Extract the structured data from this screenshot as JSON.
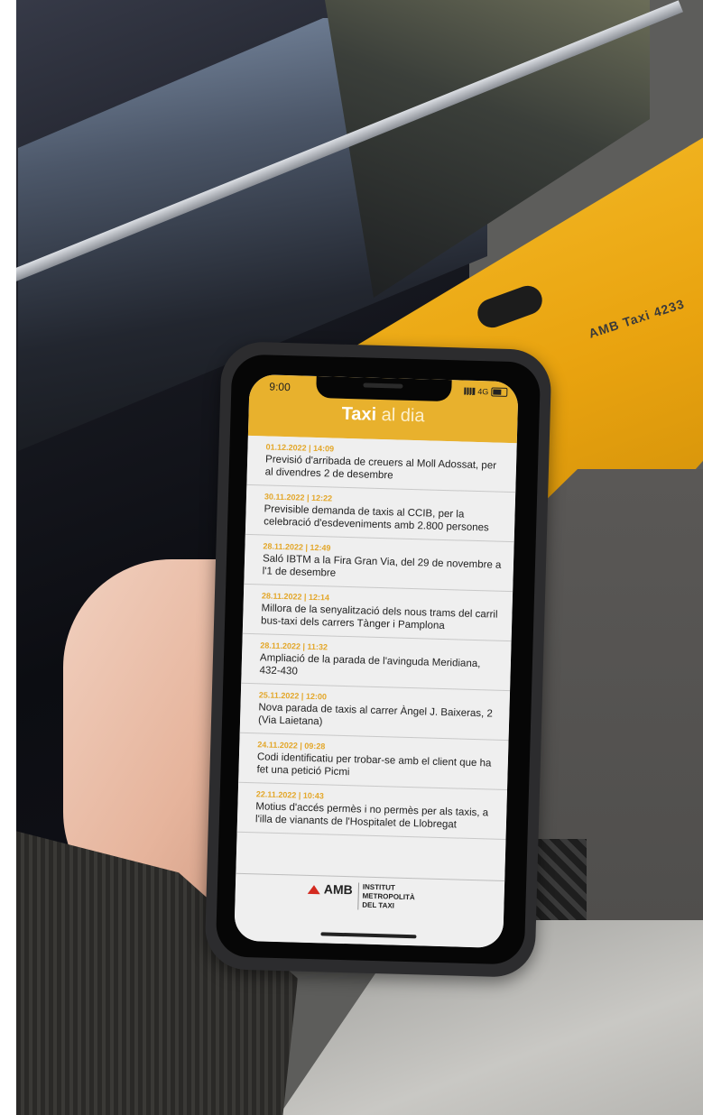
{
  "status_bar": {
    "time": "9:00",
    "network": "4G"
  },
  "app": {
    "brand_bold": "Taxi",
    "brand_light": "al dia"
  },
  "news": [
    {
      "date": "01.12.2022 | 14:09",
      "title": "Previsió d'arribada de creuers al Moll Adossat, per al divendres 2 de desembre"
    },
    {
      "date": "30.11.2022 | 12:22",
      "title": "Previsible demanda de taxis al CCIB, per la celebració d'esdeveniments amb 2.800 persones"
    },
    {
      "date": "28.11.2022 | 12:49",
      "title": "Saló IBTM a la Fira Gran Via, del 29 de novembre a l'1 de desembre"
    },
    {
      "date": "28.11.2022 | 12:14",
      "title": "Millora de la senyalització dels nous trams del carril bus-taxi dels carrers Tànger i Pamplona"
    },
    {
      "date": "28.11.2022 | 11:32",
      "title": "Ampliació de la parada de l'avinguda Meridiana, 432-430"
    },
    {
      "date": "25.11.2022 | 12:00",
      "title": "Nova parada de taxis al carrer Àngel J. Baixeras, 2 (Via Laietana)"
    },
    {
      "date": "24.11.2022 | 09:28",
      "title": "Codi identificatiu per trobar-se amb el client que ha fet una petició Picmi"
    },
    {
      "date": "22.11.2022 | 10:43",
      "title": "Motius d'accés permès i no permès per als taxis, a l'illa de vianants de l'Hospitalet de Llobregat"
    }
  ],
  "footer": {
    "logo_text": "AMB",
    "institute_line1": "INSTITUT",
    "institute_line2": "METROPOLITÀ",
    "institute_line3": "DEL TAXI"
  },
  "background": {
    "car_side_label": "AMB Taxi 4233"
  },
  "colors": {
    "header_yellow": "#e8b12d",
    "date_orange": "#e3a72a",
    "amb_red": "#d42a20"
  }
}
